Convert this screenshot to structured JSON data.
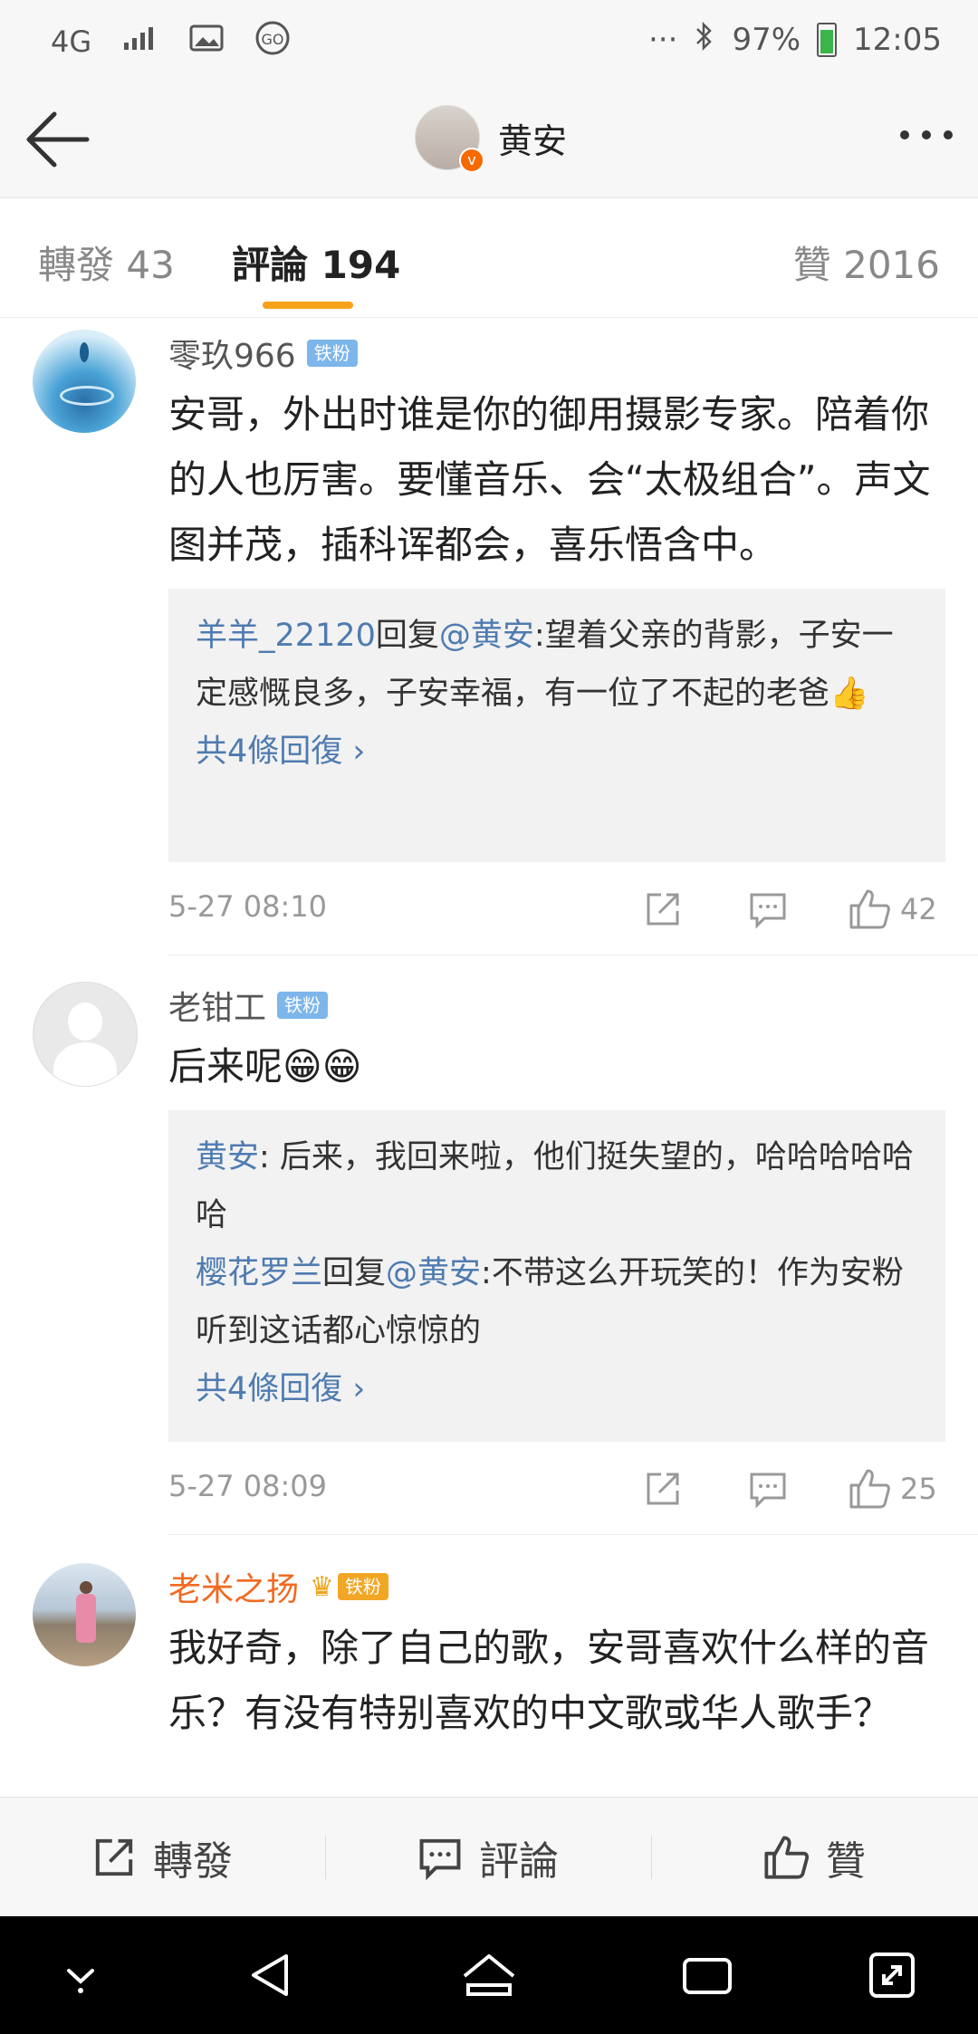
{
  "status_bar": {
    "network": "4G",
    "dots": "···",
    "battery_pct": "97%",
    "time": "12:05",
    "battery_level": 0.97
  },
  "header": {
    "title": "黄安",
    "verified_mark": "v"
  },
  "tabs": [
    {
      "label": "轉發 43"
    },
    {
      "label": "評論 194"
    },
    {
      "label": "贊 2016"
    }
  ],
  "comments": [
    {
      "username": "零玖966",
      "badge": "铁粉",
      "text": "安哥，外出时谁是你的御用摄影专家。陪着你的人也厉害。要懂音乐、会“太极组合”。声文图并茂，插科诨都会，喜乐悟含中。",
      "replies": [
        {
          "user": "羊羊_22120",
          "mid": "回复",
          "at": "@黄安",
          "content": ":望着父亲的背影，子安一定感慨良多，子安幸福，有一位了不起的老爸👍"
        }
      ],
      "more": "共4條回復 ›",
      "time": "5-27 08:10",
      "likes": "42"
    },
    {
      "username": "老钳工",
      "badge": "铁粉",
      "text": "后来呢😁😁",
      "replies": [
        {
          "user": "黄安",
          "mid": "",
          "at": "",
          "content": ": 后来，我回来啦，他们挺失望的，哈哈哈哈哈哈"
        },
        {
          "user": "樱花罗兰",
          "mid": "回复",
          "at": "@黄安",
          "content": ":不带这么开玩笑的！作为安粉听到这话都心惊惊的"
        }
      ],
      "more": "共4條回復 ›",
      "time": "5-27 08:09",
      "likes": "25"
    },
    {
      "username": "老米之扬",
      "badge": "铁粉",
      "text": "我好奇，除了自己的歌，安哥喜欢什么样的音乐？有没有特别喜欢的中文歌或华人歌手？"
    }
  ],
  "bottom_bar": {
    "repost": "轉發",
    "comment": "評論",
    "like": "贊"
  }
}
